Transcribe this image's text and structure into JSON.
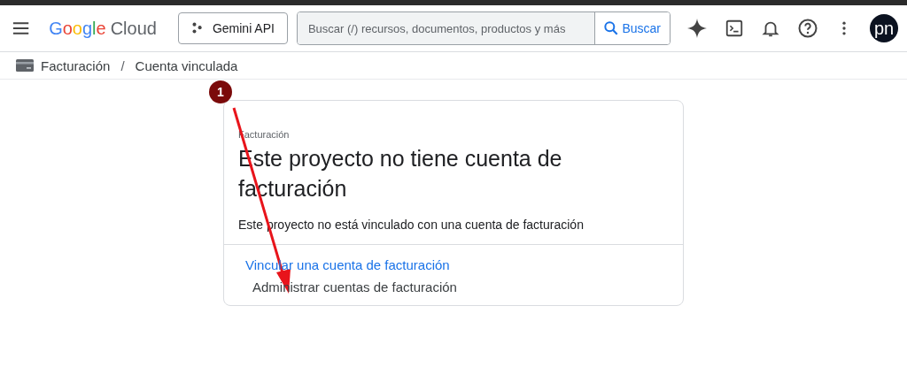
{
  "header": {
    "logo": {
      "brand": "Google",
      "product": "Cloud"
    },
    "project_button": "Gemini API",
    "search": {
      "placeholder": "Buscar (/) recursos, documentos, productos y más",
      "button": "Buscar"
    },
    "avatar": "pn"
  },
  "breadcrumb": [
    "Facturación",
    "/",
    "Cuenta vinculada"
  ],
  "card": {
    "eyebrow": "Facturación",
    "title": "Este proyecto no tiene cuenta de facturación",
    "description": "Este proyecto no está vinculado con una cuenta de facturación",
    "actions": [
      {
        "label": "Vincular una cuenta de facturación",
        "kind": "link"
      },
      {
        "label": "Administrar cuentas de facturación",
        "kind": "plain"
      }
    ]
  },
  "annotation": {
    "number": "1"
  }
}
